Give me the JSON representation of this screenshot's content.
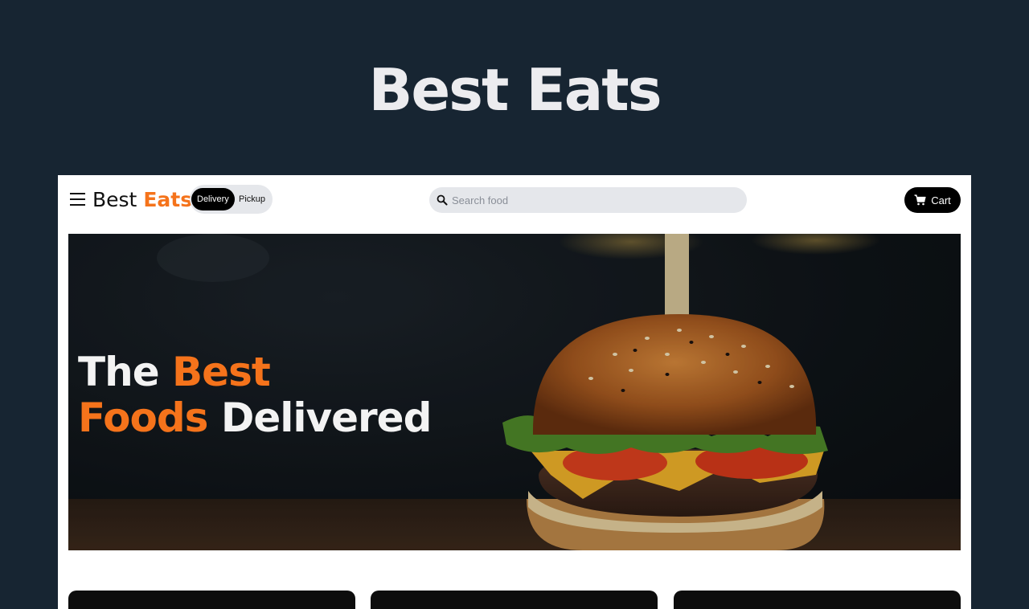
{
  "page": {
    "title": "Best Eats"
  },
  "nav": {
    "brand_main": "Best",
    "brand_accent": "Eats",
    "toggle": {
      "active": "Delivery",
      "inactive": "Pickup"
    },
    "search": {
      "placeholder": "Search food",
      "value": ""
    },
    "cart_label": "Cart"
  },
  "hero": {
    "line1_main": "The",
    "line1_accent": "Best",
    "line2_accent": "Foods",
    "line2_main": "Delivered"
  },
  "colors": {
    "accent": "#f5731b",
    "page_background": "#172532",
    "frame_background": "#ffffff",
    "pill_background": "#e5e7eb"
  },
  "icons": {
    "menu": "hamburger-menu-icon",
    "search": "magnifier-icon",
    "cart": "shopping-cart-icon"
  }
}
